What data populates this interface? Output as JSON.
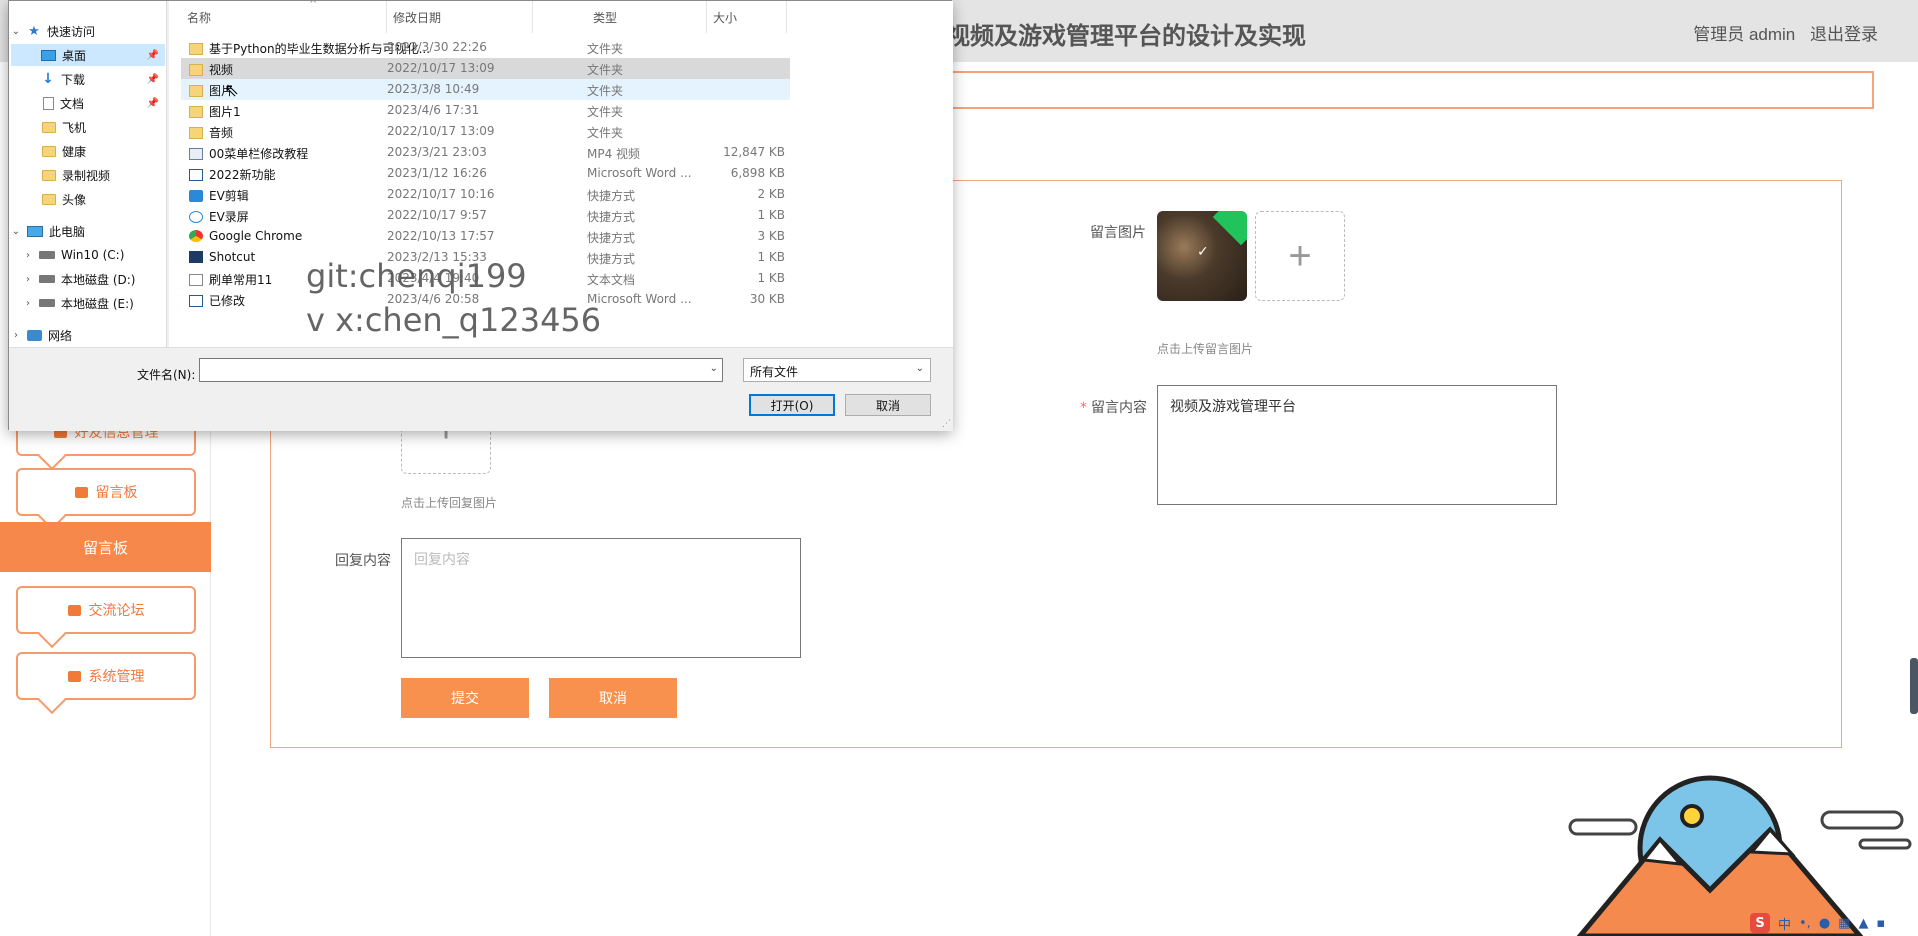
{
  "app": {
    "title": "视频及游戏管理平台的设计及实现",
    "user_label": "管理员 admin",
    "logout": "退出登录"
  },
  "sidebar": {
    "items": [
      {
        "label": "好友信息管理"
      },
      {
        "label": "留言板"
      },
      {
        "label": "留言板"
      },
      {
        "label": "交流论坛"
      },
      {
        "label": "系统管理"
      }
    ]
  },
  "form": {
    "image_label": "留言图片",
    "image_hint": "点击上传留言图片",
    "content_label": "留言内容",
    "content_value": "视频及游戏管理平台",
    "reply_image_hint": "点击上传回复图片",
    "reply_label": "回复内容",
    "reply_placeholder": "回复内容",
    "submit": "提交",
    "cancel": "取消",
    "plus": "+"
  },
  "dialog": {
    "nav": [
      {
        "label": "快速访问",
        "icon": "star-icon"
      },
      {
        "label": "桌面",
        "icon": "desktop-icon"
      },
      {
        "label": "下载",
        "icon": "download-icon"
      },
      {
        "label": "文档",
        "icon": "document-icon"
      },
      {
        "label": "飞机",
        "icon": "folder-icon"
      },
      {
        "label": "健康",
        "icon": "folder-icon"
      },
      {
        "label": "录制视频",
        "icon": "folder-icon"
      },
      {
        "label": "头像",
        "icon": "folder-icon"
      },
      {
        "label": "此电脑",
        "icon": "computer-icon"
      },
      {
        "label": "Win10 (C:)",
        "icon": "drive-icon"
      },
      {
        "label": "本地磁盘 (D:)",
        "icon": "drive-icon"
      },
      {
        "label": "本地磁盘 (E:)",
        "icon": "drive-icon"
      },
      {
        "label": "网络",
        "icon": "network-icon"
      }
    ],
    "columns": {
      "name": "名称",
      "date": "修改日期",
      "type": "类型",
      "size": "大小"
    },
    "files": [
      {
        "name": "基于Python的毕业生数据分析与可视化...",
        "date": "2023/3/30 22:26",
        "type": "文件夹",
        "size": "",
        "icon": "folder"
      },
      {
        "name": "视频",
        "date": "2022/10/17 13:09",
        "type": "文件夹",
        "size": "",
        "icon": "folder"
      },
      {
        "name": "图片",
        "date": "2023/3/8 10:49",
        "type": "文件夹",
        "size": "",
        "icon": "folder"
      },
      {
        "name": "图片1",
        "date": "2023/4/6 17:31",
        "type": "文件夹",
        "size": "",
        "icon": "folder"
      },
      {
        "name": "音频",
        "date": "2022/10/17 13:09",
        "type": "文件夹",
        "size": "",
        "icon": "folder"
      },
      {
        "name": "00菜单栏修改教程",
        "date": "2023/3/21 23:03",
        "type": "MP4 视频",
        "size": "12,847 KB",
        "icon": "video"
      },
      {
        "name": "2022新功能",
        "date": "2023/1/12 16:26",
        "type": "Microsoft Word ...",
        "size": "6,898 KB",
        "icon": "word"
      },
      {
        "name": "EV剪辑",
        "date": "2022/10/17 10:16",
        "type": "快捷方式",
        "size": "2 KB",
        "icon": "ev"
      },
      {
        "name": "EV录屏",
        "date": "2022/10/17 9:57",
        "type": "快捷方式",
        "size": "1 KB",
        "icon": "ev2"
      },
      {
        "name": "Google Chrome",
        "date": "2022/10/13 17:57",
        "type": "快捷方式",
        "size": "3 KB",
        "icon": "chrome"
      },
      {
        "name": "Shotcut",
        "date": "2023/2/13 15:33",
        "type": "快捷方式",
        "size": "1 KB",
        "icon": "shot"
      },
      {
        "name": "刷单常用11",
        "date": "2023/4/4 19:40",
        "type": "文本文档",
        "size": "1 KB",
        "icon": "txt"
      },
      {
        "name": "已修改",
        "date": "2023/4/6 20:58",
        "type": "Microsoft Word ...",
        "size": "30 KB",
        "icon": "word"
      }
    ],
    "filename_label": "文件名(N):",
    "filename_value": "",
    "filetype": "所有文件",
    "open_button": "打开(O)",
    "cancel_button": "取消"
  },
  "watermark": {
    "line1": "git:chenqi199",
    "line2": "v x:chen_q123456"
  },
  "tray": {
    "ime": "S",
    "ime_lang": "中"
  }
}
